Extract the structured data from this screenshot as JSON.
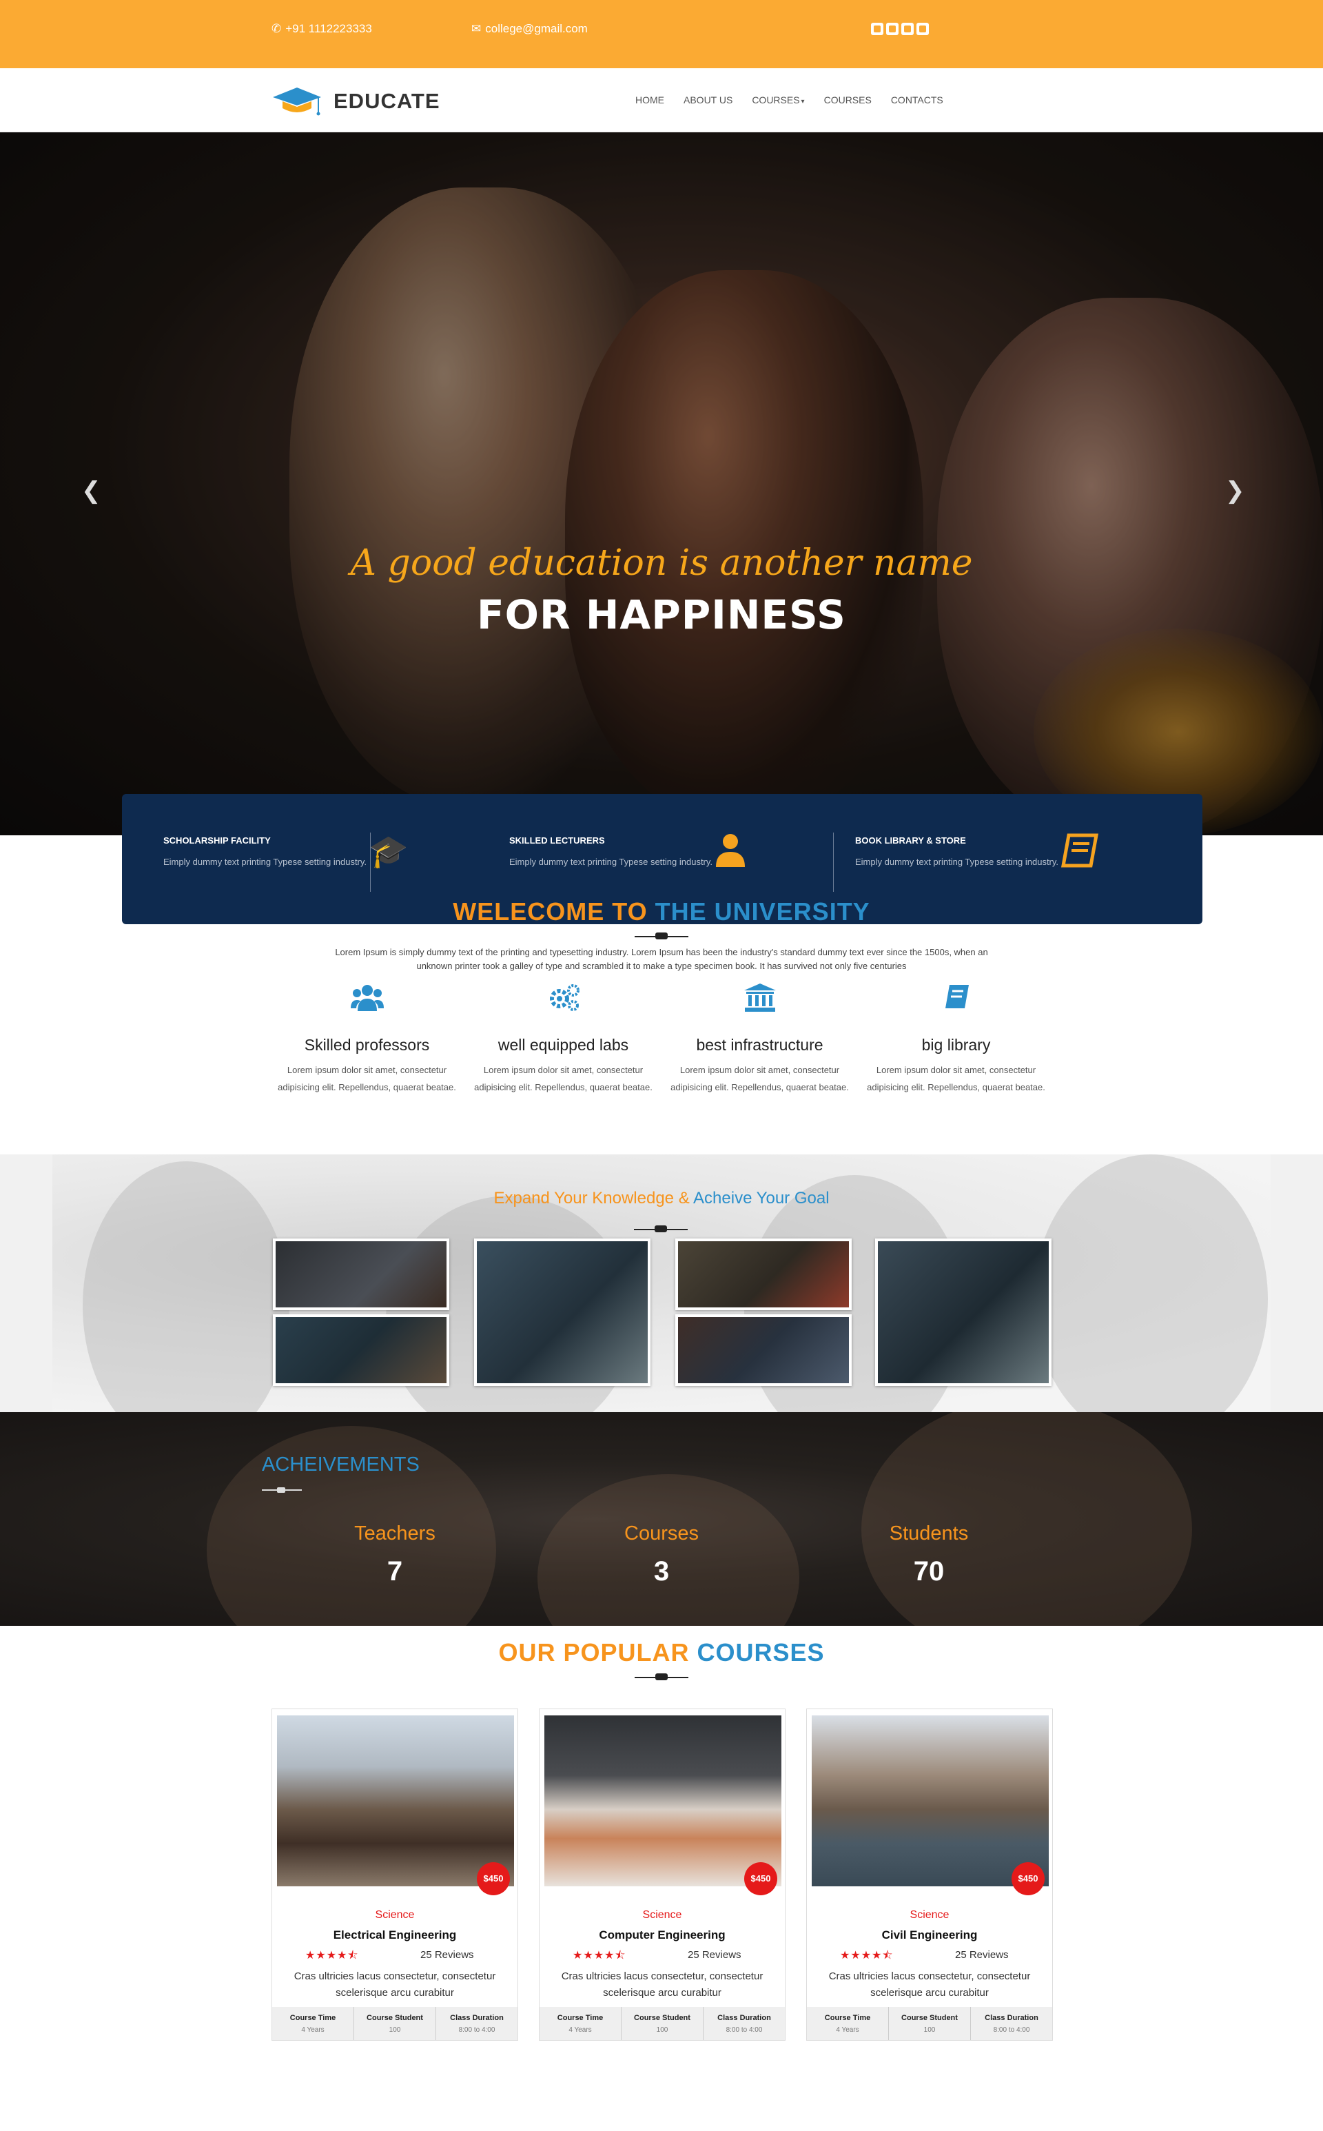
{
  "topbar": {
    "phone": "+91 1112223333",
    "email": "college@gmail.com",
    "social_icons": [
      "twitter-icon",
      "google-plus-icon",
      "facebook-icon",
      "youtube-icon"
    ],
    "bg_color": "#fbaa33"
  },
  "nav": {
    "brand": "EDUCATE",
    "items": [
      {
        "label": "HOME"
      },
      {
        "label": "ABOUT US"
      },
      {
        "label": "COURSES",
        "dropdown": true
      },
      {
        "label": "COURSES"
      },
      {
        "label": "CONTACTS"
      }
    ]
  },
  "hero": {
    "script_line": "A good education is another name",
    "headline": "FOR HAPPINESS",
    "slides": 4,
    "active_slide": 2
  },
  "features": [
    {
      "title": "SCHOLARSHIP FACILITY",
      "text": "Eimply dummy text printing Typese setting industry.",
      "icon": "graduation-cap-icon"
    },
    {
      "title": "SKILLED LECTURERS",
      "text": "Eimply dummy text printing Typese setting industry.",
      "icon": "user-icon"
    },
    {
      "title": "BOOK LIBRARY & STORE",
      "text": "Eimply dummy text printing Typese setting industry.",
      "icon": "book-icon"
    }
  ],
  "welcome": {
    "title_a": "WELECOME TO",
    "title_b": "THE UNIVERSITY",
    "intro": "Lorem Ipsum is simply dummy text of the printing and typesetting industry. Lorem Ipsum has been the industry's standard dummy text ever since the 1500s, when an unknown printer took a galley of type and scrambled it to make a type specimen book. It has survived not only five centuries",
    "pillars": [
      {
        "title": "Skilled professors",
        "text": "Lorem ipsum dolor sit amet, consectetur adipisicing elit. Repellendus, quaerat beatae.",
        "icon": "users-icon"
      },
      {
        "title": "well equipped labs",
        "text": "Lorem ipsum dolor sit amet, consectetur adipisicing elit. Repellendus, quaerat beatae.",
        "icon": "cogs-icon"
      },
      {
        "title": "best infrastructure",
        "text": "Lorem ipsum dolor sit amet, consectetur adipisicing elit. Repellendus, quaerat beatae.",
        "icon": "institution-icon"
      },
      {
        "title": "big library",
        "text": "Lorem ipsum dolor sit amet, consectetur adipisicing elit. Repellendus, quaerat beatae.",
        "icon": "book-icon"
      }
    ]
  },
  "gallery": {
    "title_a": "Expand Your Knowledge &",
    "title_b": "Acheive Your Goal"
  },
  "achievements": {
    "title": "ACHEIVEMENTS",
    "stats": [
      {
        "label": "Teachers",
        "value": "7"
      },
      {
        "label": "Courses",
        "value": "3"
      },
      {
        "label": "Students",
        "value": "70"
      }
    ]
  },
  "courses": {
    "title_a": "OUR POPULAR",
    "title_b": "COURSES",
    "items": [
      {
        "price": "$450",
        "category": "Science",
        "name": "Electrical Engineering",
        "rating": 4.5,
        "reviews": "25 Reviews",
        "desc": "Cras ultricies lacus consectetur, consectetur scelerisque arcu curabitur",
        "meta": [
          {
            "k": "Course Time",
            "v": "4 Years"
          },
          {
            "k": "Course Student",
            "v": "100"
          },
          {
            "k": "Class Duration",
            "v": "8:00 to 4:00"
          }
        ]
      },
      {
        "price": "$450",
        "category": "Science",
        "name": "Computer Engineering",
        "rating": 4.5,
        "reviews": "25 Reviews",
        "desc": "Cras ultricies lacus consectetur, consectetur scelerisque arcu curabitur",
        "meta": [
          {
            "k": "Course Time",
            "v": "4 Years"
          },
          {
            "k": "Course Student",
            "v": "100"
          },
          {
            "k": "Class Duration",
            "v": "8:00 to 4:00"
          }
        ]
      },
      {
        "price": "$450",
        "category": "Science",
        "name": "Civil Engineering",
        "rating": 4.5,
        "reviews": "25 Reviews",
        "desc": "Cras ultricies lacus consectetur, consectetur scelerisque arcu curabitur",
        "meta": [
          {
            "k": "Course Time",
            "v": "4 Years"
          },
          {
            "k": "Course Student",
            "v": "100"
          },
          {
            "k": "Class Duration",
            "v": "8:00 to 4:00"
          }
        ]
      }
    ]
  },
  "colors": {
    "accent_orange": "#f7941d",
    "accent_blue": "#2b8fcb",
    "navy": "#0e2a4f",
    "price_red": "#e51a1a"
  }
}
